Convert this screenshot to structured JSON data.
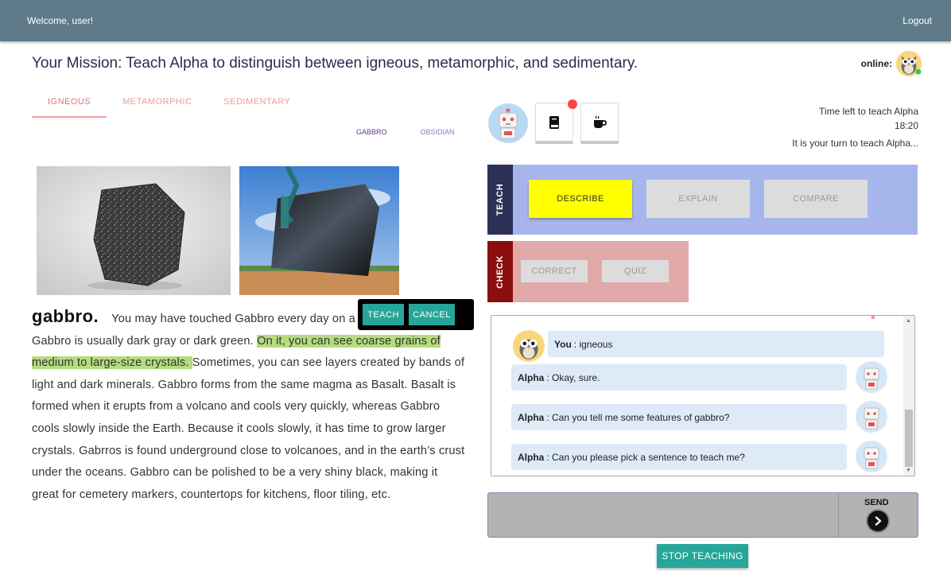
{
  "topbar": {
    "welcome": "Welcome, user!",
    "logout": "Logout"
  },
  "mission": "Your Mission: Teach Alpha to distinguish between igneous, metamorphic, and sedimentary.",
  "online_label": "online:",
  "tabs": [
    {
      "label": "IGNEOUS",
      "active": true
    },
    {
      "label": "METAMORPHIC",
      "active": false
    },
    {
      "label": "SEDIMENTARY",
      "active": false
    }
  ],
  "subtabs": [
    {
      "label": "GABBRO",
      "active": true
    },
    {
      "label": "OBSIDIAN",
      "active": false
    }
  ],
  "passage": {
    "title": "gabbro.",
    "before": "You may have touched Gabbro every day on a kitchen countertop. Gabbro is usually dark gray or dark green. ",
    "highlight": "On it, you can see coarse grains of medium to large-size crystals. ",
    "after": "Sometimes, you can see layers created by bands of light and dark minerals. Gabbro forms from the same magma as Basalt. Basalt is formed when it erupts from a volcano and cools very quickly, whereas Gabbro cools slowly inside the Earth. Because it cools slowly, it has time to grow larger crystals. Gabrros is found underground close to volcanoes, and in the earth’s crust under the oceans. Gabbro can be polished to be a very shiny black, making it great for cemetery markers, countertops for kitchens, floor tiling, etc."
  },
  "popup": {
    "teach": "TEACH",
    "cancel": "CANCEL"
  },
  "status": {
    "time_label": "Time left to teach Alpha",
    "time_value": "18:20",
    "turn": "It is your turn to teach Alpha..."
  },
  "teach_panel": {
    "label": "TEACH",
    "buttons": [
      {
        "label": "DESCRIBE",
        "active": true
      },
      {
        "label": "EXPLAIN",
        "active": false
      },
      {
        "label": "COMPARE",
        "active": false
      }
    ]
  },
  "check_panel": {
    "label": "CHECK",
    "buttons": [
      {
        "label": "CORRECT"
      },
      {
        "label": "QUIZ"
      }
    ]
  },
  "chat": [
    {
      "speaker": "You",
      "text": ": igneous"
    },
    {
      "speaker": "Alpha",
      "text": ": Okay, sure."
    },
    {
      "speaker": "Alpha",
      "text": ": Can you tell me some features of gabbro?"
    },
    {
      "speaker": "Alpha",
      "text": ": Can you please pick a sentence to teach me?"
    }
  ],
  "send_label": "SEND",
  "stop_label": "STOP TEACHING",
  "colors": {
    "topbar": "#5f7b8a",
    "teal": "#26a69a",
    "teach_bg": "#a6b6ed",
    "check_bg": "#e2a9a9",
    "highlight": "#b5dc7e",
    "describe": "#ffff00"
  },
  "icons": {
    "book": "book-icon",
    "coffee": "coffee-icon",
    "send": "chevron-right-icon",
    "owl": "owl-avatar",
    "robot": "robot-avatar"
  }
}
